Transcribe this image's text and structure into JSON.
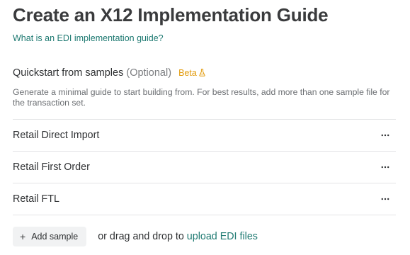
{
  "header": {
    "title": "Create an X12 Implementation Guide",
    "help_link": "What is an EDI implementation guide?"
  },
  "quickstart": {
    "title": "Quickstart from samples",
    "optional": "(Optional)",
    "beta": "Beta",
    "beta_icon": "flask-icon",
    "beta_color": "#e29a0a",
    "description": "Generate a minimal guide to start building from. For best results, add more than one sample file for the transaction set."
  },
  "samples": [
    {
      "name": "Retail Direct Import"
    },
    {
      "name": "Retail First Order"
    },
    {
      "name": "Retail FTL"
    }
  ],
  "footer": {
    "add_button": "Add sample",
    "add_icon": "plus-icon",
    "drag_text": "or drag and drop to",
    "upload_link": "upload EDI files"
  },
  "colors": {
    "link": "#1f7a72",
    "beta": "#e29a0a"
  }
}
